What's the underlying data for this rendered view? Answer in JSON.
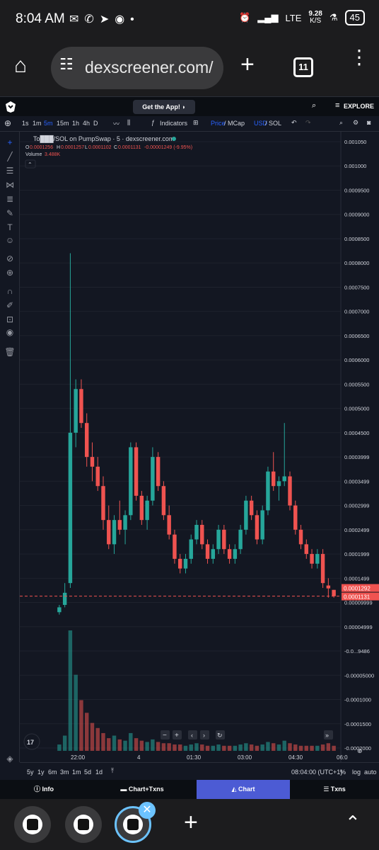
{
  "status": {
    "time": "8:04 AM",
    "net": "LTE",
    "speed": "9.28",
    "speed_unit": "K/S",
    "battery": "45"
  },
  "browser": {
    "url": "dexscreener.com/",
    "tab_count": "11"
  },
  "header": {
    "get_app": "Get the App!",
    "explore": "EXPLORE"
  },
  "toolbar": {
    "intervals": [
      "1s",
      "1m",
      "5m",
      "15m",
      "1h",
      "4h",
      "D"
    ],
    "active_interval": "5m",
    "indicators": "Indicators",
    "price_label": "Price",
    "mcap_label": "MCap",
    "usd_label": "USD",
    "sol_label": "SOL"
  },
  "legend": {
    "pair": "To███/SOL on PumpSwap · 5 · dexscreener.com",
    "o": "0.0001256",
    "h": "0.0001257",
    "l": "0.0001102",
    "c": "0.0001131",
    "change": "-0.00001249 (-9.95%)",
    "volume_label": "Volume",
    "volume": "3.488K"
  },
  "price_axis": {
    "ticks": [
      "0.001050",
      "0.001000",
      "0.0009500",
      "0.0009000",
      "0.0008500",
      "0.0008000",
      "0.0007500",
      "0.0007000",
      "0.0006500",
      "0.0006000",
      "0.0005500",
      "0.0005000",
      "0.0004500",
      "0.0003999",
      "0.0003499",
      "0.0002999",
      "0.0002499",
      "0.0001999",
      "0.0001499",
      "0.00009999",
      "0.00004999",
      "-0.0...9486",
      "-0.00005000",
      "-0.0001000",
      "-0.0001500",
      "-0.0002000"
    ],
    "last_price": "0.0001292",
    "current_price": "0.0001131"
  },
  "time_axis": [
    "22:00",
    "4",
    "01:30",
    "03:00",
    "04:30",
    "06:0"
  ],
  "bottom": {
    "ranges": [
      "5y",
      "1y",
      "6m",
      "3m",
      "1m",
      "5d",
      "1d"
    ],
    "clock": "08:04:00 (UTC+1)",
    "percent": "%",
    "log": "log",
    "auto": "auto"
  },
  "tabs": [
    "Info",
    "Chart+Txns",
    "Chart",
    "Txns"
  ],
  "colors": {
    "up": "#26a69a",
    "down": "#ef5350",
    "bg": "#131722",
    "accent": "#2962ff",
    "tab_active": "#4c5bd4"
  },
  "chart_data": {
    "type": "candlestick",
    "ylim": [
      -0.0002,
      0.00105
    ],
    "candles": [
      [
        8e-05,
        9.5e-05,
        7.5e-05,
        9e-05
      ],
      [
        9.5e-05,
        0.00014,
        9e-05,
        0.00012
      ],
      [
        0.00014,
        0.00082,
        0.00013,
        0.00045
      ],
      [
        0.00045,
        0.00056,
        0.00042,
        0.00054
      ],
      [
        0.00054,
        0.00056,
        0.00046,
        0.00047
      ],
      [
        0.00047,
        0.00049,
        0.00038,
        0.0004
      ],
      [
        0.0004,
        0.00043,
        0.00035,
        0.00038
      ],
      [
        0.00038,
        0.0004,
        0.00033,
        0.00034
      ],
      [
        0.00034,
        0.00036,
        0.00025,
        0.00027
      ],
      [
        0.00027,
        0.0003,
        0.00021,
        0.00022
      ],
      [
        0.00022,
        0.00028,
        0.0002,
        0.00027
      ],
      [
        0.00027,
        0.00031,
        0.00024,
        0.00025
      ],
      [
        0.00025,
        0.00029,
        0.00022,
        0.00028
      ],
      [
        0.00028,
        0.00043,
        0.00027,
        0.00042
      ],
      [
        0.00042,
        0.00043,
        0.00031,
        0.00032
      ],
      [
        0.00032,
        0.00033,
        0.00026,
        0.00027
      ],
      [
        0.00027,
        0.00032,
        0.00025,
        0.00031
      ],
      [
        0.00031,
        0.00042,
        0.0003,
        0.0004
      ],
      [
        0.0004,
        0.00041,
        0.00033,
        0.00034
      ],
      [
        0.00034,
        0.00035,
        0.00027,
        0.00028
      ],
      [
        0.00028,
        0.0003,
        0.00023,
        0.00024
      ],
      [
        0.00024,
        0.00025,
        0.00018,
        0.00019
      ],
      [
        0.00019,
        0.0002,
        0.00016,
        0.00017
      ],
      [
        0.00017,
        0.0002,
        0.00016,
        0.00019
      ],
      [
        0.00019,
        0.00024,
        0.00018,
        0.00023
      ],
      [
        0.00023,
        0.00027,
        0.00022,
        0.00026
      ],
      [
        0.00026,
        0.00027,
        0.00021,
        0.00022
      ],
      [
        0.00022,
        0.00023,
        0.00018,
        0.00019
      ],
      [
        0.00019,
        0.00022,
        0.00018,
        0.00021
      ],
      [
        0.00021,
        0.00026,
        0.0002,
        0.00025
      ],
      [
        0.00025,
        0.00026,
        0.0002,
        0.00021
      ],
      [
        0.00021,
        0.00022,
        0.00018,
        0.00019
      ],
      [
        0.00019,
        0.00022,
        0.00018,
        0.00021
      ],
      [
        0.00021,
        0.00026,
        0.0002,
        0.00025
      ],
      [
        0.00025,
        0.00032,
        0.00024,
        0.00031
      ],
      [
        0.00031,
        0.00032,
        0.00027,
        0.00028
      ],
      [
        0.00028,
        0.00029,
        0.00022,
        0.00023
      ],
      [
        0.00023,
        0.0003,
        0.00022,
        0.00029
      ],
      [
        0.00029,
        0.00038,
        0.00028,
        0.00037
      ],
      [
        0.00037,
        0.00041,
        0.00033,
        0.00034
      ],
      [
        0.00034,
        0.00036,
        0.00031,
        0.00035
      ],
      [
        0.00035,
        0.00047,
        0.00034,
        0.00036
      ],
      [
        0.00036,
        0.00037,
        0.00029,
        0.0003
      ],
      [
        0.0003,
        0.00031,
        0.00024,
        0.00025
      ],
      [
        0.00025,
        0.00026,
        0.00021,
        0.00022
      ],
      [
        0.00022,
        0.00023,
        0.00019,
        0.0002
      ],
      [
        0.0002,
        0.00021,
        0.00017,
        0.00018
      ],
      [
        0.00018,
        0.00021,
        0.00017,
        0.0002
      ],
      [
        0.0002,
        0.00021,
        0.00013,
        0.00014
      ],
      [
        0.000135,
        0.00015,
        0.00011,
        0.000129
      ],
      [
        0.000126,
        0.000126,
        0.00011,
        0.000113
      ]
    ],
    "volumes": [
      5,
      12,
      95,
      60,
      40,
      30,
      22,
      18,
      14,
      10,
      12,
      9,
      8,
      14,
      10,
      8,
      7,
      9,
      7,
      6,
      6,
      5,
      5,
      4,
      5,
      6,
      5,
      4,
      4,
      5,
      4,
      4,
      4,
      5,
      6,
      5,
      4,
      5,
      7,
      6,
      5,
      8,
      6,
      5,
      4,
      4,
      4,
      4,
      5,
      6,
      4
    ]
  }
}
